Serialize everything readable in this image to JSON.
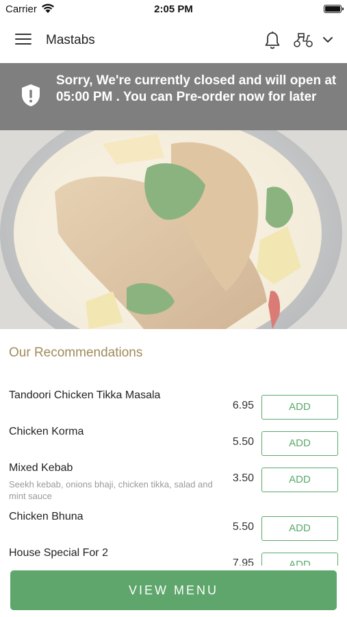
{
  "status_bar": {
    "carrier": "Carrier",
    "time": "2:05 PM"
  },
  "header": {
    "title": "Mastabs"
  },
  "banner": {
    "message": "Sorry, We're currently closed and will open at 05:00 PM . You can Pre-order now for later"
  },
  "recommendations": {
    "title": "Our Recommendations",
    "add_label": "ADD",
    "items": [
      {
        "name": "Tandoori Chicken Tikka Masala",
        "price": "6.95",
        "description": ""
      },
      {
        "name": "Chicken Korma",
        "price": "5.50",
        "description": ""
      },
      {
        "name": "Mixed Kebab",
        "price": "3.50",
        "description": "Seekh kebab, onions bhaji, chicken tikka, salad and mint sauce"
      },
      {
        "name": "Chicken Bhuna",
        "price": "5.50",
        "description": ""
      },
      {
        "name": "House Special For 2",
        "price": "7.95",
        "description": ""
      }
    ]
  },
  "footer": {
    "view_menu_label": "VIEW MENU"
  },
  "colors": {
    "accent_green": "#5fa66c",
    "banner_gray": "#7f7f7f",
    "section_title": "#a08a5a"
  },
  "icons": [
    "wifi-icon",
    "battery-icon",
    "hamburger-menu-icon",
    "bell-icon",
    "scooter-icon",
    "chevron-down-icon",
    "shield-alert-icon"
  ]
}
